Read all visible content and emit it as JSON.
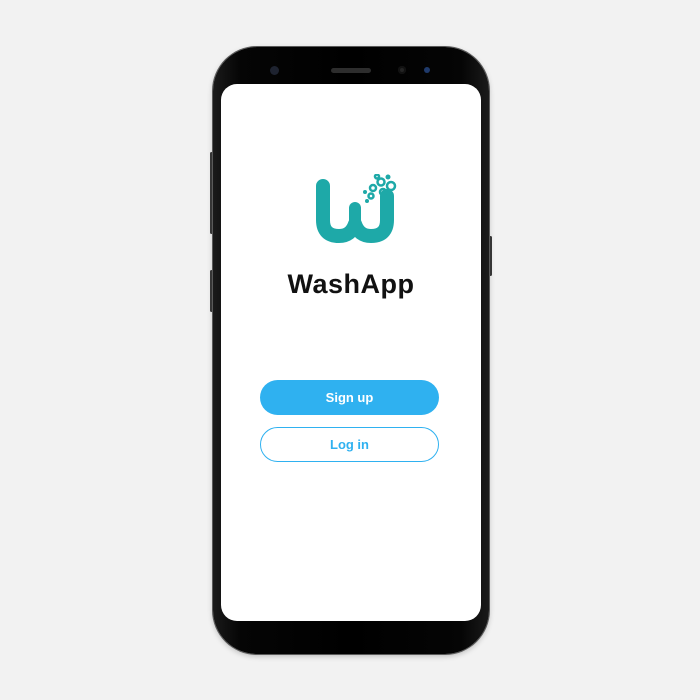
{
  "app": {
    "name": "WashApp",
    "brand_color": "#1ea9a8",
    "accent_color": "#2fb1f0"
  },
  "logo": {
    "icon": "washapp-w-bubbles-logo"
  },
  "actions": {
    "signup_label": "Sign up",
    "login_label": "Log in"
  }
}
